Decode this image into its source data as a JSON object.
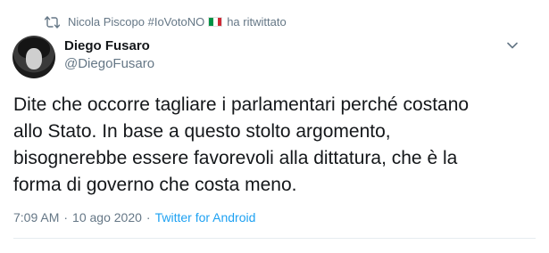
{
  "retweet": {
    "icon": "retweet-icon",
    "user": "Nicola Piscopo #IoVotoNO",
    "flag_colors": [
      "#009246",
      "#ffffff",
      "#ce2b37"
    ],
    "suffix": "ha ritwittato"
  },
  "author": {
    "display_name": "Diego Fusaro",
    "handle": "@DiegoFusaro",
    "avatar": "avatar"
  },
  "tweet": {
    "text": "Dite che occorre tagliare i parlamentari perché costano\nallo Stato. In base a questo stolto argomento,\nbisognerebbe essere favorevoli alla dittatura, che è la\nforma di governo che costa meno."
  },
  "meta": {
    "time": "7:09 AM",
    "date": "10 ago 2020",
    "separator": "·",
    "dot": "·",
    "source": "Twitter for Android"
  },
  "colors": {
    "secondary_text": "#657786",
    "link": "#1da1f2",
    "primary_text": "#14171a"
  }
}
